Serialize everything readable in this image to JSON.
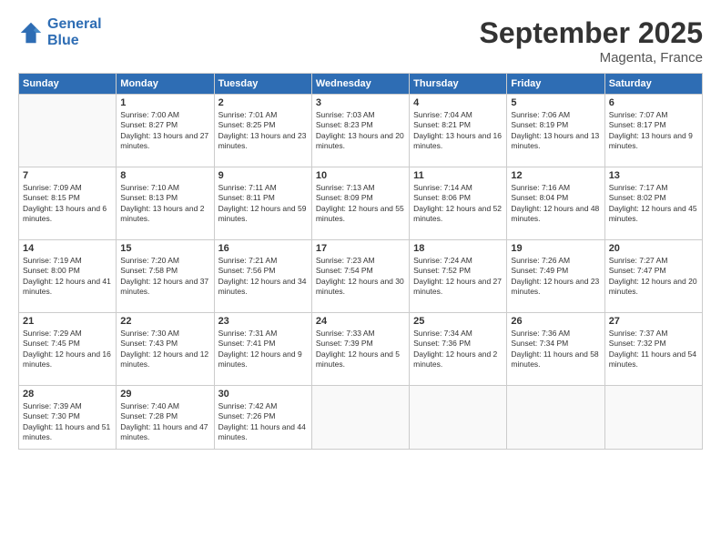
{
  "header": {
    "logo_line1": "General",
    "logo_line2": "Blue",
    "month": "September 2025",
    "location": "Magenta, France"
  },
  "weekdays": [
    "Sunday",
    "Monday",
    "Tuesday",
    "Wednesday",
    "Thursday",
    "Friday",
    "Saturday"
  ],
  "weeks": [
    [
      {
        "day": "",
        "sunrise": "",
        "sunset": "",
        "daylight": ""
      },
      {
        "day": "1",
        "sunrise": "Sunrise: 7:00 AM",
        "sunset": "Sunset: 8:27 PM",
        "daylight": "Daylight: 13 hours and 27 minutes."
      },
      {
        "day": "2",
        "sunrise": "Sunrise: 7:01 AM",
        "sunset": "Sunset: 8:25 PM",
        "daylight": "Daylight: 13 hours and 23 minutes."
      },
      {
        "day": "3",
        "sunrise": "Sunrise: 7:03 AM",
        "sunset": "Sunset: 8:23 PM",
        "daylight": "Daylight: 13 hours and 20 minutes."
      },
      {
        "day": "4",
        "sunrise": "Sunrise: 7:04 AM",
        "sunset": "Sunset: 8:21 PM",
        "daylight": "Daylight: 13 hours and 16 minutes."
      },
      {
        "day": "5",
        "sunrise": "Sunrise: 7:06 AM",
        "sunset": "Sunset: 8:19 PM",
        "daylight": "Daylight: 13 hours and 13 minutes."
      },
      {
        "day": "6",
        "sunrise": "Sunrise: 7:07 AM",
        "sunset": "Sunset: 8:17 PM",
        "daylight": "Daylight: 13 hours and 9 minutes."
      }
    ],
    [
      {
        "day": "7",
        "sunrise": "Sunrise: 7:09 AM",
        "sunset": "Sunset: 8:15 PM",
        "daylight": "Daylight: 13 hours and 6 minutes."
      },
      {
        "day": "8",
        "sunrise": "Sunrise: 7:10 AM",
        "sunset": "Sunset: 8:13 PM",
        "daylight": "Daylight: 13 hours and 2 minutes."
      },
      {
        "day": "9",
        "sunrise": "Sunrise: 7:11 AM",
        "sunset": "Sunset: 8:11 PM",
        "daylight": "Daylight: 12 hours and 59 minutes."
      },
      {
        "day": "10",
        "sunrise": "Sunrise: 7:13 AM",
        "sunset": "Sunset: 8:09 PM",
        "daylight": "Daylight: 12 hours and 55 minutes."
      },
      {
        "day": "11",
        "sunrise": "Sunrise: 7:14 AM",
        "sunset": "Sunset: 8:06 PM",
        "daylight": "Daylight: 12 hours and 52 minutes."
      },
      {
        "day": "12",
        "sunrise": "Sunrise: 7:16 AM",
        "sunset": "Sunset: 8:04 PM",
        "daylight": "Daylight: 12 hours and 48 minutes."
      },
      {
        "day": "13",
        "sunrise": "Sunrise: 7:17 AM",
        "sunset": "Sunset: 8:02 PM",
        "daylight": "Daylight: 12 hours and 45 minutes."
      }
    ],
    [
      {
        "day": "14",
        "sunrise": "Sunrise: 7:19 AM",
        "sunset": "Sunset: 8:00 PM",
        "daylight": "Daylight: 12 hours and 41 minutes."
      },
      {
        "day": "15",
        "sunrise": "Sunrise: 7:20 AM",
        "sunset": "Sunset: 7:58 PM",
        "daylight": "Daylight: 12 hours and 37 minutes."
      },
      {
        "day": "16",
        "sunrise": "Sunrise: 7:21 AM",
        "sunset": "Sunset: 7:56 PM",
        "daylight": "Daylight: 12 hours and 34 minutes."
      },
      {
        "day": "17",
        "sunrise": "Sunrise: 7:23 AM",
        "sunset": "Sunset: 7:54 PM",
        "daylight": "Daylight: 12 hours and 30 minutes."
      },
      {
        "day": "18",
        "sunrise": "Sunrise: 7:24 AM",
        "sunset": "Sunset: 7:52 PM",
        "daylight": "Daylight: 12 hours and 27 minutes."
      },
      {
        "day": "19",
        "sunrise": "Sunrise: 7:26 AM",
        "sunset": "Sunset: 7:49 PM",
        "daylight": "Daylight: 12 hours and 23 minutes."
      },
      {
        "day": "20",
        "sunrise": "Sunrise: 7:27 AM",
        "sunset": "Sunset: 7:47 PM",
        "daylight": "Daylight: 12 hours and 20 minutes."
      }
    ],
    [
      {
        "day": "21",
        "sunrise": "Sunrise: 7:29 AM",
        "sunset": "Sunset: 7:45 PM",
        "daylight": "Daylight: 12 hours and 16 minutes."
      },
      {
        "day": "22",
        "sunrise": "Sunrise: 7:30 AM",
        "sunset": "Sunset: 7:43 PM",
        "daylight": "Daylight: 12 hours and 12 minutes."
      },
      {
        "day": "23",
        "sunrise": "Sunrise: 7:31 AM",
        "sunset": "Sunset: 7:41 PM",
        "daylight": "Daylight: 12 hours and 9 minutes."
      },
      {
        "day": "24",
        "sunrise": "Sunrise: 7:33 AM",
        "sunset": "Sunset: 7:39 PM",
        "daylight": "Daylight: 12 hours and 5 minutes."
      },
      {
        "day": "25",
        "sunrise": "Sunrise: 7:34 AM",
        "sunset": "Sunset: 7:36 PM",
        "daylight": "Daylight: 12 hours and 2 minutes."
      },
      {
        "day": "26",
        "sunrise": "Sunrise: 7:36 AM",
        "sunset": "Sunset: 7:34 PM",
        "daylight": "Daylight: 11 hours and 58 minutes."
      },
      {
        "day": "27",
        "sunrise": "Sunrise: 7:37 AM",
        "sunset": "Sunset: 7:32 PM",
        "daylight": "Daylight: 11 hours and 54 minutes."
      }
    ],
    [
      {
        "day": "28",
        "sunrise": "Sunrise: 7:39 AM",
        "sunset": "Sunset: 7:30 PM",
        "daylight": "Daylight: 11 hours and 51 minutes."
      },
      {
        "day": "29",
        "sunrise": "Sunrise: 7:40 AM",
        "sunset": "Sunset: 7:28 PM",
        "daylight": "Daylight: 11 hours and 47 minutes."
      },
      {
        "day": "30",
        "sunrise": "Sunrise: 7:42 AM",
        "sunset": "Sunset: 7:26 PM",
        "daylight": "Daylight: 11 hours and 44 minutes."
      },
      {
        "day": "",
        "sunrise": "",
        "sunset": "",
        "daylight": ""
      },
      {
        "day": "",
        "sunrise": "",
        "sunset": "",
        "daylight": ""
      },
      {
        "day": "",
        "sunrise": "",
        "sunset": "",
        "daylight": ""
      },
      {
        "day": "",
        "sunrise": "",
        "sunset": "",
        "daylight": ""
      }
    ]
  ]
}
